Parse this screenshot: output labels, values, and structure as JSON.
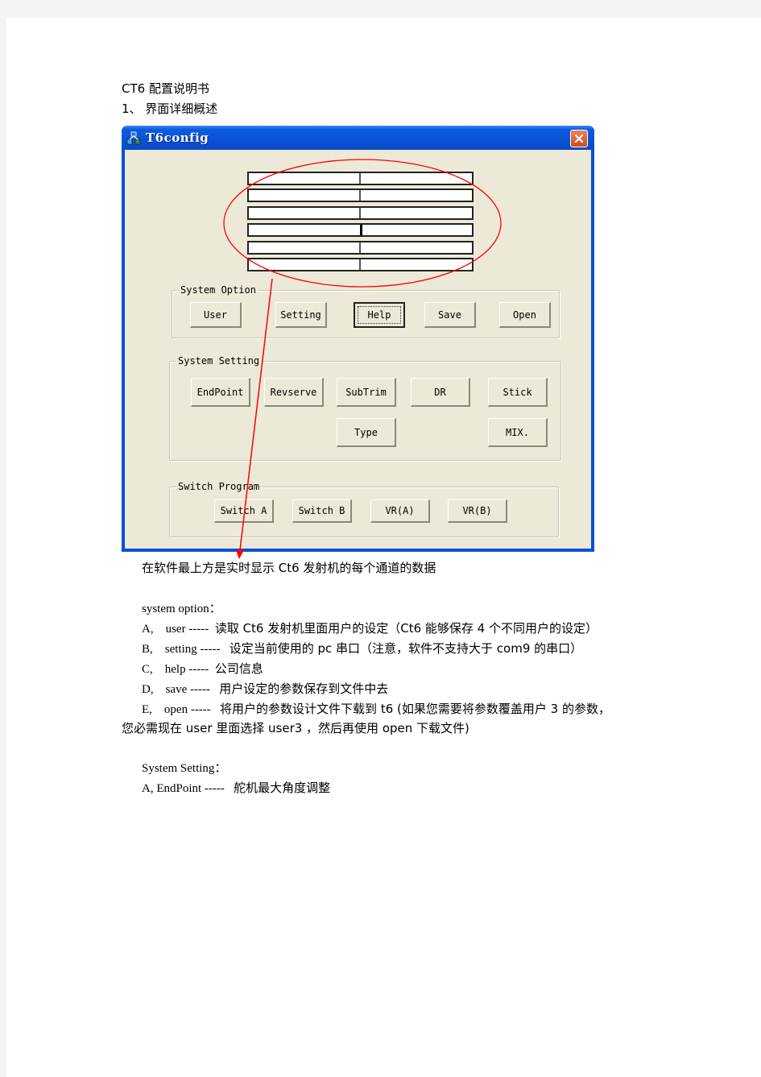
{
  "doc": {
    "title": "CT6  配置说明书",
    "section_heading": "1、 界面详细概述",
    "caption": "在软件最上方是实时显示 Ct6 发射机的每个通道的数据",
    "system_option": {
      "heading": "system  option：",
      "items": [
        {
          "key": "A,    user -----",
          "desc": "读取 Ct6 发射机里面用户的设定（Ct6 能够保存 4 个不同用户的设定）"
        },
        {
          "key": "B,    setting -----",
          "desc": "设定当前使用的 pc 串口（注意，软件不支持大于 com9 的串口）"
        },
        {
          "key": "C,    help -----",
          "desc": "公司信息"
        },
        {
          "key": "D,    save -----",
          "desc": "用户设定的参数保存到文件中去"
        },
        {
          "key": "E,    open -----",
          "desc": "将用户的参数设计文件下载到 t6 (如果您需要将参数覆盖用户 3 的参数，"
        }
      ],
      "continuation": "您必需现在 user 里面选择 user3  ，然后再使用 open 下载文件)"
    },
    "system_setting": {
      "heading": "System  Setting：",
      "items": [
        {
          "key": "A, EndPoint -----",
          "desc": "舵机最大角度调整"
        }
      ]
    }
  },
  "window": {
    "title": "T6config",
    "app_icon": "app-network-icon",
    "close_icon": "close-icon",
    "channel_rows": 6,
    "system_option": {
      "label": "System Option",
      "buttons": [
        "User",
        "Setting",
        "Help",
        "Save",
        "Open"
      ]
    },
    "system_setting": {
      "label": "System Setting",
      "buttons": [
        "EndPoint",
        "Revserve",
        "SubTrim",
        "DR",
        "Stick",
        "Type",
        "MIX."
      ]
    },
    "switch_program": {
      "label": "Switch Program",
      "buttons": [
        "Switch A",
        "Switch B",
        "VR(A)",
        "VR(B)"
      ]
    }
  },
  "annotation": {
    "color": "#ff0000",
    "shapes": [
      "ellipse-around-channel-table",
      "arrow-to-caption"
    ]
  }
}
